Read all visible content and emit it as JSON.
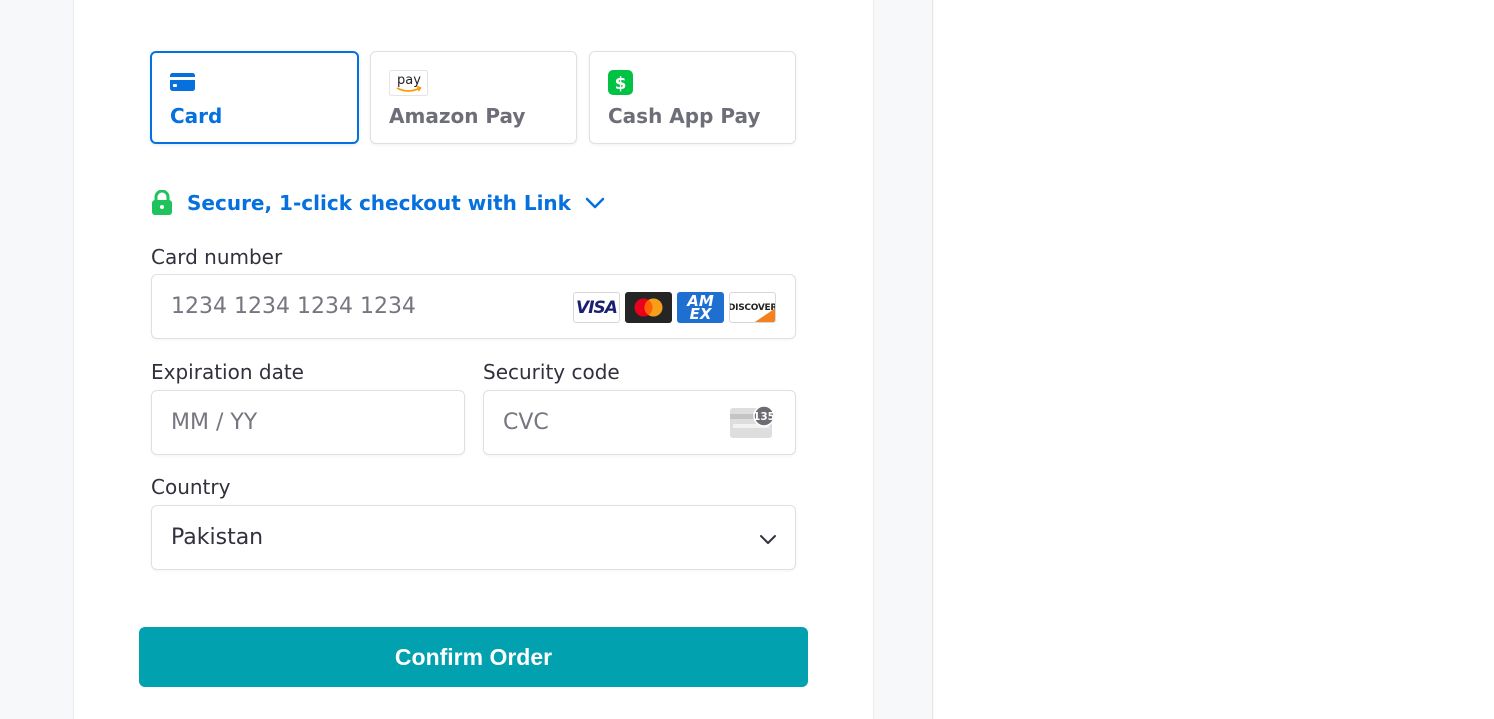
{
  "payment_methods": [
    {
      "label": "Card",
      "icon": "credit-card-icon",
      "selected": true
    },
    {
      "label": "Amazon Pay",
      "icon": "amazon-pay-icon",
      "icon_text": "pay",
      "selected": false
    },
    {
      "label": "Cash App Pay",
      "icon": "cash-app-icon",
      "icon_text": "$",
      "selected": false
    }
  ],
  "link": {
    "text": "Secure, 1-click checkout with Link",
    "icon": "lock-icon"
  },
  "card_number": {
    "label": "Card number",
    "placeholder": "1234 1234 1234 1234"
  },
  "brands": {
    "visa": "VISA",
    "amex": "AM EX",
    "discover": "DISCOVER"
  },
  "expiration": {
    "label": "Expiration date",
    "placeholder": "MM / YY"
  },
  "security_code": {
    "label": "Security code",
    "placeholder": "CVC",
    "cvc_badge": "135"
  },
  "country": {
    "label": "Country",
    "value": "Pakistan"
  },
  "confirm_button": {
    "label": "Confirm Order"
  },
  "colors": {
    "accent": "#0570de",
    "button": "#02a1b0",
    "lock": "#1fc35c",
    "cash_app": "#00c244"
  }
}
